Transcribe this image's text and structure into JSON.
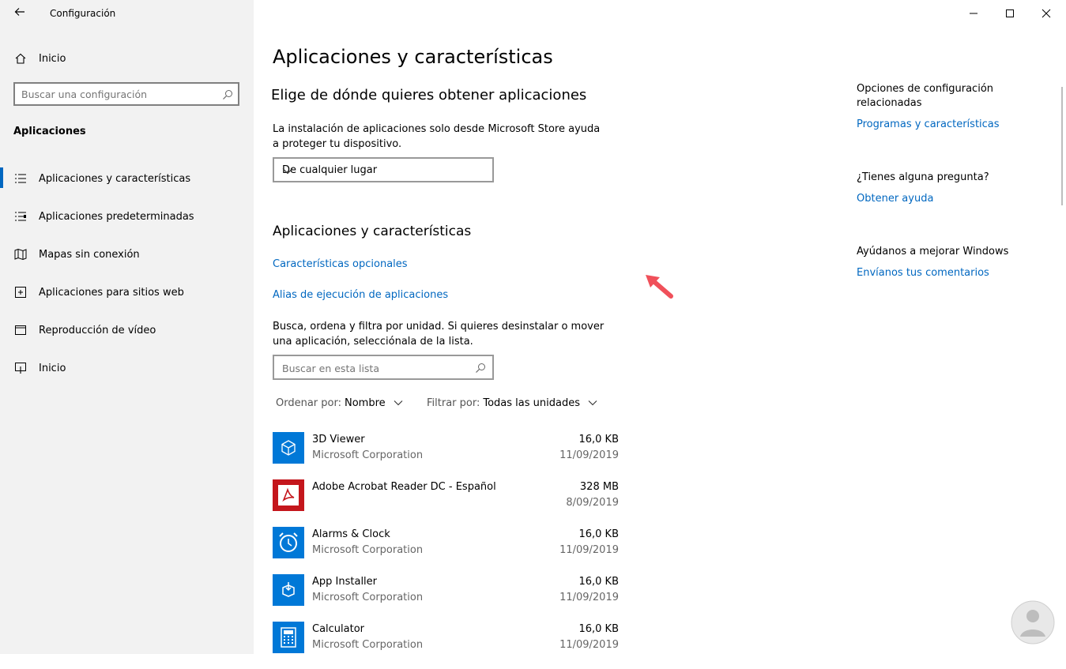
{
  "window": {
    "title": "Configuración",
    "controls": [
      "minimize",
      "maximize",
      "close"
    ]
  },
  "sidebar": {
    "home_label": "Inicio",
    "search_placeholder": "Buscar una configuración",
    "section_title": "Aplicaciones",
    "items": [
      {
        "label": "Aplicaciones y características",
        "icon": "list-icon",
        "selected": true
      },
      {
        "label": "Aplicaciones predeterminadas",
        "icon": "default-apps-icon",
        "selected": false
      },
      {
        "label": "Mapas sin conexión",
        "icon": "map-icon",
        "selected": false
      },
      {
        "label": "Aplicaciones para sitios web",
        "icon": "website-app-icon",
        "selected": false
      },
      {
        "label": "Reproducción de vídeo",
        "icon": "video-icon",
        "selected": false
      },
      {
        "label": "Inicio",
        "icon": "startup-icon",
        "selected": false
      }
    ]
  },
  "main": {
    "page_title": "Aplicaciones y características",
    "choose_heading": "Elige de dónde quieres obtener aplicaciones",
    "choose_desc": "La instalación de aplicaciones solo desde Microsoft Store ayuda a proteger tu dispositivo.",
    "source_dropdown_value": "De cualquier lugar",
    "apps_heading": "Aplicaciones y características",
    "optional_features_link": "Características opcionales",
    "alias_link": "Alias de ejecución de aplicaciones",
    "list_desc": "Busca, ordena y filtra por unidad. Si quieres desinstalar o mover una aplicación, selecciónala de la lista.",
    "list_search_placeholder": "Buscar en esta lista",
    "sort_key": "Ordenar por:",
    "sort_value": "Nombre",
    "filter_key": "Filtrar por:",
    "filter_value": "Todas las unidades",
    "apps": [
      {
        "name": "3D Viewer",
        "publisher": "Microsoft Corporation",
        "size": "16,0 KB",
        "date": "11/09/2019",
        "icon": "3d-viewer-icon",
        "color": "#0078d7"
      },
      {
        "name": "Adobe Acrobat Reader DC - Español",
        "publisher": "",
        "size": "328 MB",
        "date": "8/09/2019",
        "icon": "acrobat-icon",
        "color": "#c4161c"
      },
      {
        "name": "Alarms & Clock",
        "publisher": "Microsoft Corporation",
        "size": "16,0 KB",
        "date": "11/09/2019",
        "icon": "alarm-clock-icon",
        "color": "#0078d7"
      },
      {
        "name": "App Installer",
        "publisher": "Microsoft Corporation",
        "size": "16,0 KB",
        "date": "11/09/2019",
        "icon": "app-installer-icon",
        "color": "#0078d7"
      },
      {
        "name": "Calculator",
        "publisher": "Microsoft Corporation",
        "size": "16,0 KB",
        "date": "11/09/2019",
        "icon": "calculator-icon",
        "color": "#0078d7"
      }
    ]
  },
  "related": {
    "settings_title": "Opciones de configuración relacionadas",
    "programs_link": "Programas y características",
    "question": "¿Tienes alguna pregunta?",
    "help_link": "Obtener ayuda",
    "improve": "Ayúdanos a mejorar Windows",
    "feedback_link": "Envíanos tus comentarios"
  },
  "colors": {
    "accent": "#0067c0",
    "sidebar_bg": "#f2f2f2",
    "app_tile_blue": "#0078d7",
    "annotation_arrow": "#f0505a"
  }
}
